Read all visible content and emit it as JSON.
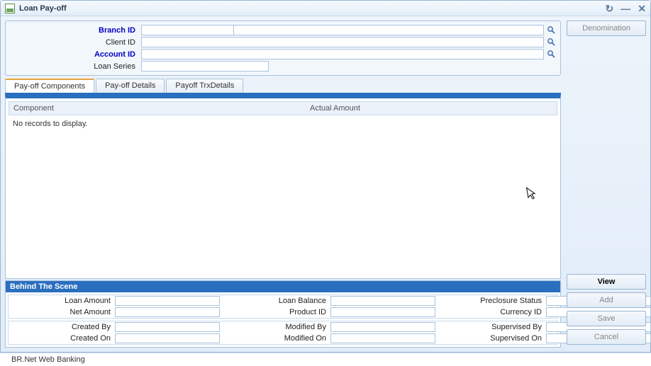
{
  "window": {
    "title": "Loan Pay-off"
  },
  "form": {
    "branch_id_label": "Branch ID",
    "client_id_label": "Client ID",
    "account_id_label": "Account ID",
    "loan_series_label": "Loan Series",
    "branch_id_code": "",
    "branch_id_name": "",
    "client_id": "",
    "account_id": "",
    "loan_series": ""
  },
  "tabs": [
    {
      "label": "Pay-off Components",
      "active": true
    },
    {
      "label": "Pay-off Details",
      "active": false
    },
    {
      "label": "Payoff TrxDetails",
      "active": false
    }
  ],
  "grid": {
    "columns": {
      "component": "Component",
      "actual_amount": "Actual Amount"
    },
    "empty_text": "No records to display.",
    "rows": []
  },
  "behind_the_scene": {
    "title": "Behind The Scene",
    "row1": {
      "loan_amount_label": "Loan Amount",
      "loan_amount": "",
      "loan_balance_label": "Loan Balance",
      "loan_balance": "",
      "preclosure_status_label": "Preclosure Status",
      "preclosure_status": ""
    },
    "row2": {
      "net_amount_label": "Net Amount",
      "net_amount": "",
      "product_id_label": "Product ID",
      "product_id": "",
      "currency_id_label": "Currency ID",
      "currency_id": ""
    },
    "row3": {
      "created_by_label": "Created By",
      "created_by": "",
      "modified_by_label": "Modified By",
      "modified_by": "",
      "supervised_by_label": "Supervised By",
      "supervised_by": ""
    },
    "row4": {
      "created_on_label": "Created On",
      "created_on": "",
      "modified_on_label": "Modified On",
      "modified_on": "",
      "supervised_on_label": "Supervised On",
      "supervised_on": ""
    }
  },
  "buttons": {
    "denomination": "Denomination",
    "view": "View",
    "add": "Add",
    "save": "Save",
    "cancel": "Cancel"
  },
  "footer": {
    "text": "BR.Net Web Banking"
  }
}
